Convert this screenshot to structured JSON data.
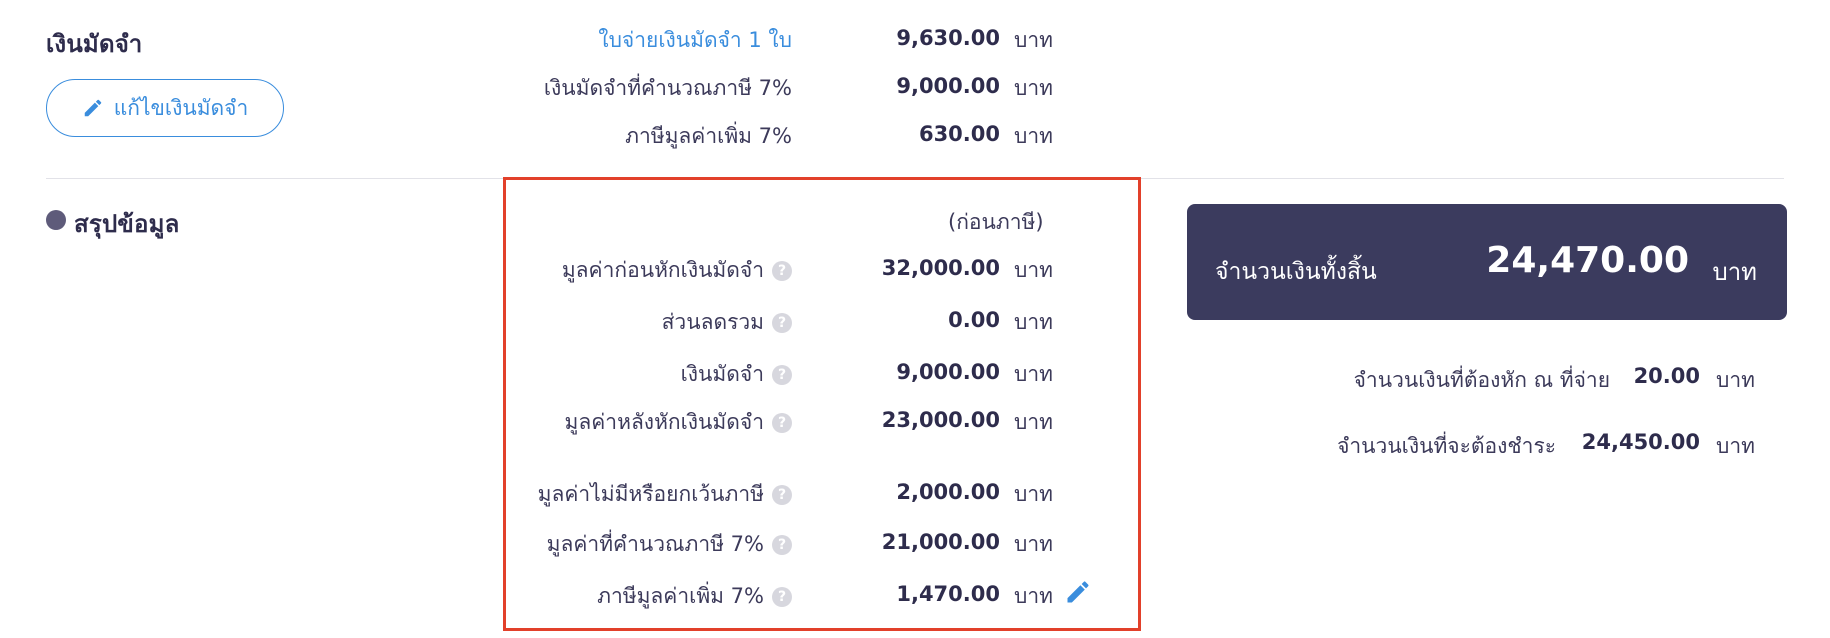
{
  "deposit": {
    "title": "เงินมัดจำ",
    "edit_button": "แก้ไขเงินมัดจำ",
    "receipt_link": "ใบจ่ายเงินมัดจำ 1 ใบ",
    "receipt_amount": "9,630.00",
    "taxable_label": "เงินมัดจำที่คำนวณภาษี 7%",
    "taxable_amount": "9,000.00",
    "vat_label": "ภาษีมูลค่าเพิ่ม 7%",
    "vat_amount": "630.00"
  },
  "unit": "บาท",
  "summary": {
    "title": "สรุปข้อมูล",
    "before_tax_note": "(ก่อนภาษี)",
    "rows": [
      {
        "label": "มูลค่าก่อนหักเงินมัดจำ",
        "value": "32,000.00"
      },
      {
        "label": "ส่วนลดรวม",
        "value": "0.00"
      },
      {
        "label": "เงินมัดจำ",
        "value": "9,000.00"
      },
      {
        "label": "มูลค่าหลังหักเงินมัดจำ",
        "value": "23,000.00"
      },
      {
        "label": "มูลค่าไม่มีหรือยกเว้นภาษี",
        "value": "2,000.00"
      },
      {
        "label": "มูลค่าที่คำนวณภาษี 7%",
        "value": "21,000.00"
      },
      {
        "label": "ภาษีมูลค่าเพิ่ม 7%",
        "value": "1,470.00"
      }
    ],
    "help_glyph": "?"
  },
  "totals": {
    "grand_label": "จำนวนเงินทั้งสิ้น",
    "grand_value": "24,470.00",
    "withholding_label": "จำนวนเงินที่ต้องหัก ณ ที่จ่าย",
    "withholding_value": "20.00",
    "payable_label": "จำนวนเงินที่จะต้องชำระ",
    "payable_value": "24,450.00"
  },
  "colors": {
    "accent": "#3a8ddd",
    "highlight": "#e2402a",
    "total_bg": "#3b3b5e"
  },
  "icons": {
    "edit": "pencil-icon",
    "help": "help-circle-icon",
    "bullet": "bullet-dot"
  }
}
